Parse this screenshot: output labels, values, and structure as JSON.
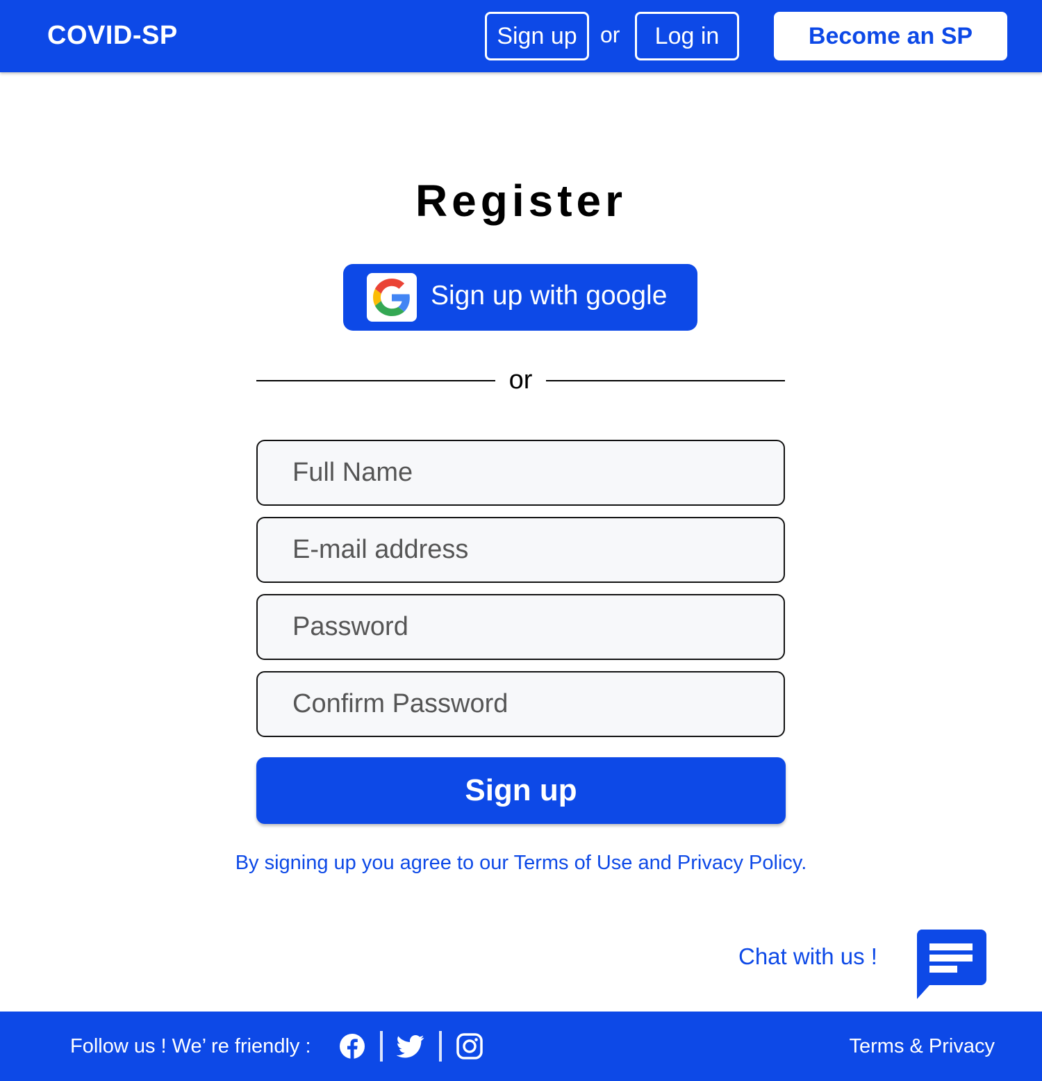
{
  "header": {
    "logo": "COVID-SP",
    "signup_label": "Sign up",
    "or_label": "or",
    "login_label": "Log in",
    "become_label": "Become an SP"
  },
  "main": {
    "title": "Register",
    "google_label": "Sign up with google",
    "divider_label": "or",
    "fields": {
      "full_name_placeholder": "Full Name",
      "email_placeholder": "E-mail address",
      "password_placeholder": "Password",
      "confirm_password_placeholder": "Confirm Password"
    },
    "submit_label": "Sign up",
    "terms_prefix": "By signing up you agree to our ",
    "terms_link": "Terms of Use and Privacy Policy",
    "terms_suffix": "."
  },
  "chat": {
    "label": "Chat with us !",
    "icon": "chat-bubble-icon"
  },
  "footer": {
    "follow_label": "Follow us !  We’ re friendly :",
    "social_icons": [
      "facebook-icon",
      "twitter-icon",
      "instagram-icon"
    ],
    "terms_label": "Terms & Privacy"
  },
  "colors": {
    "brand_blue": "#0d49e7",
    "field_bg": "#f7f8fa"
  }
}
